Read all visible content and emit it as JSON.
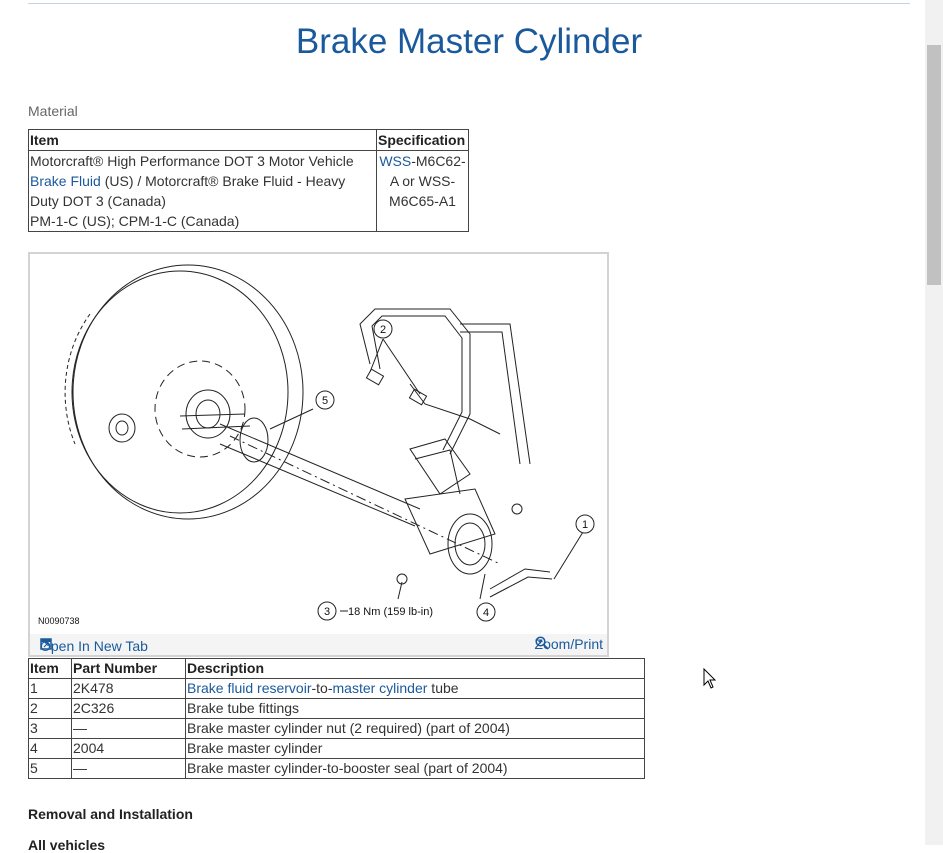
{
  "page": {
    "title": "Brake Master Cylinder",
    "material_label": "Material"
  },
  "spec_table": {
    "headers": [
      "Item",
      "Specification"
    ],
    "item_prefix": "Motorcraft® High Performance DOT 3 Motor Vehicle ",
    "item_link": "Brake Fluid",
    "item_rest": " (US) / Motorcraft® Brake Fluid - Heavy Duty DOT 3 (Canada)",
    "item_line2": "PM-1-C (US); CPM-1-C (Canada)",
    "spec_link": "WSS",
    "spec_rest": "-M6C62-A or WSS-M6C65-A1"
  },
  "figure": {
    "id": "N0090738",
    "open_tab": "Open In New Tab",
    "zoom": "Zoom/Print",
    "torque_label": "18 Nm (159 lb-in)",
    "callouts": [
      "1",
      "2",
      "3",
      "4",
      "5"
    ]
  },
  "parts_table": {
    "headers": [
      "Item",
      "Part Number",
      "Description"
    ],
    "rows": [
      {
        "item": "1",
        "part": "2K478",
        "desc_link1": "Brake fluid reservoir",
        "desc_mid": "-to-",
        "desc_link2": "master cylinder",
        "desc_rest": " tube"
      },
      {
        "item": "2",
        "part": "2C326",
        "desc": "Brake tube fittings"
      },
      {
        "item": "3",
        "part": "—",
        "desc": "Brake master cylinder nut (2 required) (part of 2004)"
      },
      {
        "item": "4",
        "part": "2004",
        "desc": "Brake master cylinder"
      },
      {
        "item": "5",
        "part": "—",
        "desc": "Brake master cylinder-to-booster seal (part of 2004)"
      }
    ]
  },
  "sections": {
    "removal": "Removal and Installation",
    "all_vehicles": "All vehicles"
  }
}
